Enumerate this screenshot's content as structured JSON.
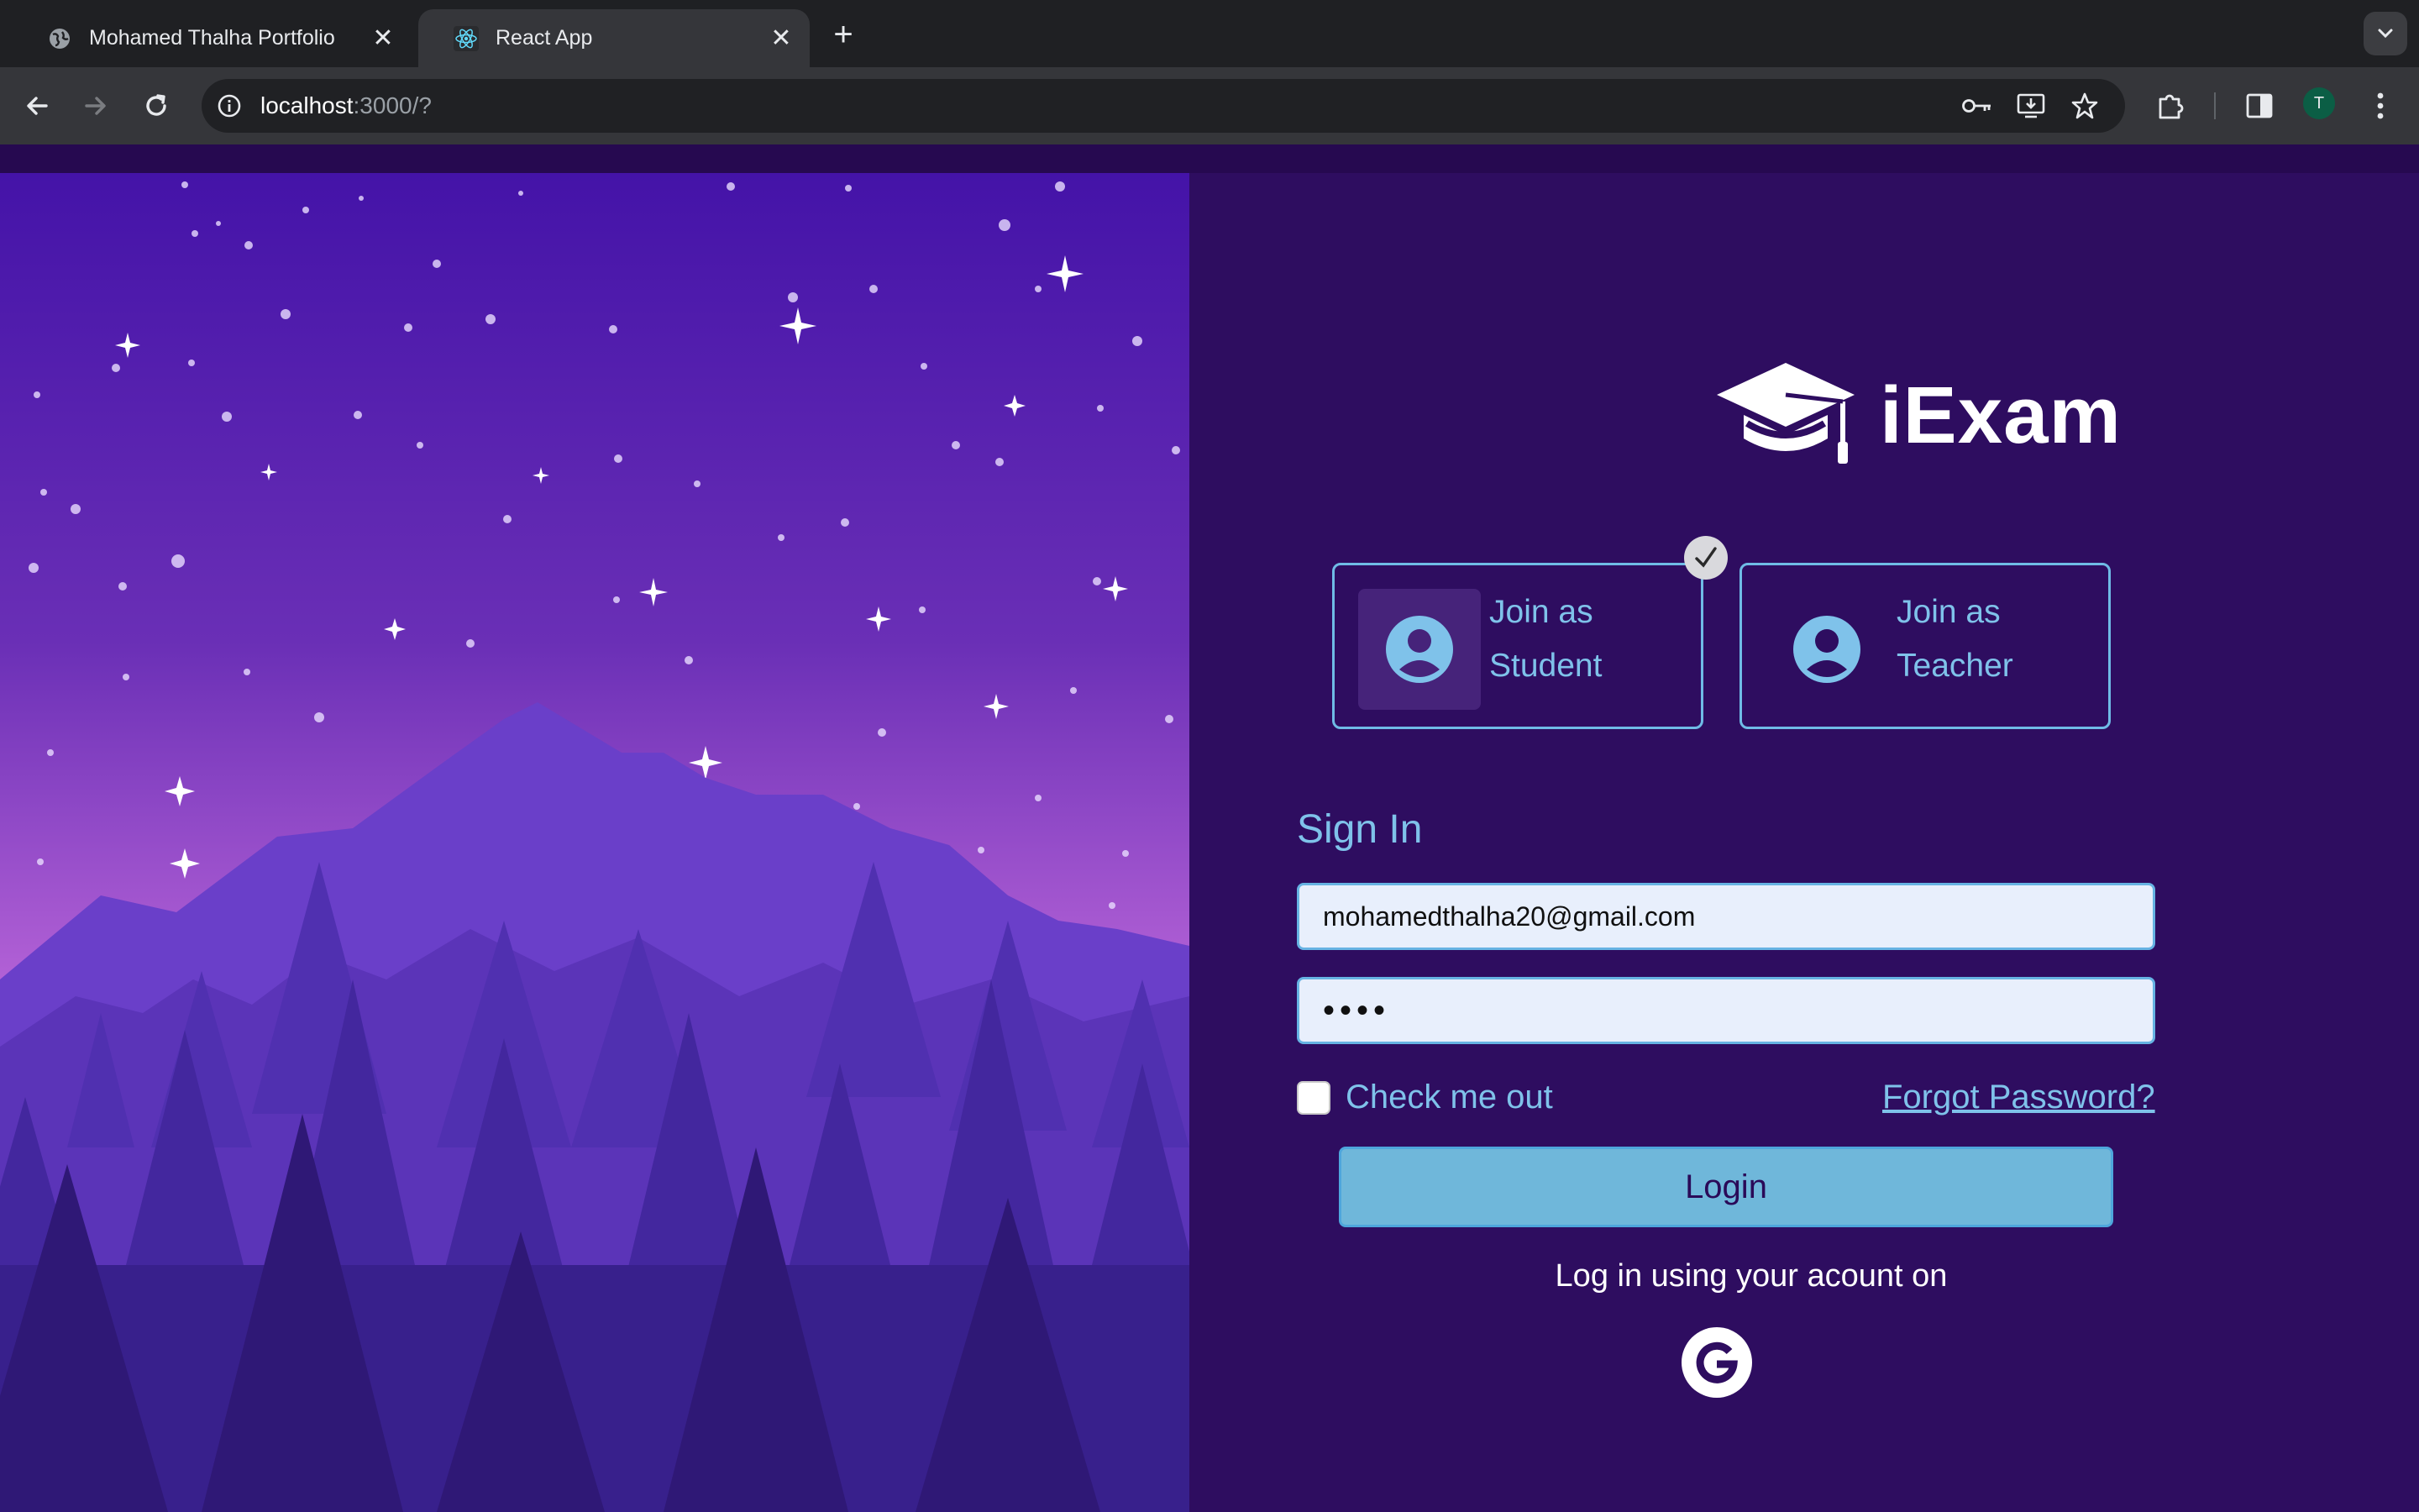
{
  "browser": {
    "tabs": [
      {
        "title": "Mohamed Thalha Portfolio",
        "active": false,
        "favicon": "globe-icon"
      },
      {
        "title": "React App",
        "active": true,
        "favicon": "react-icon"
      }
    ],
    "url_host": "localhost",
    "url_rest": ":3000/?",
    "profile_initial": "T"
  },
  "brand": {
    "name": "iExam",
    "logo": "graduation-cap-icon"
  },
  "roles": {
    "student_line1": "Join as",
    "student_line2": "Student",
    "teacher_line1": "Join as",
    "teacher_line2": "Teacher",
    "selected": "student"
  },
  "signin": {
    "title": "Sign In",
    "email_value": "mohamedthalha20@gmail.com",
    "password_value": "••••",
    "remember_label": "Check me out",
    "remember_checked": false,
    "forgot_label": "Forgot Password?",
    "login_label": "Login",
    "alt_text": "Log in using your acount on",
    "alt_provider": "google-icon"
  },
  "colors": {
    "page_bg": "#2e0d60",
    "accent": "#7fc2ea",
    "button_bg": "#6fb7da"
  }
}
